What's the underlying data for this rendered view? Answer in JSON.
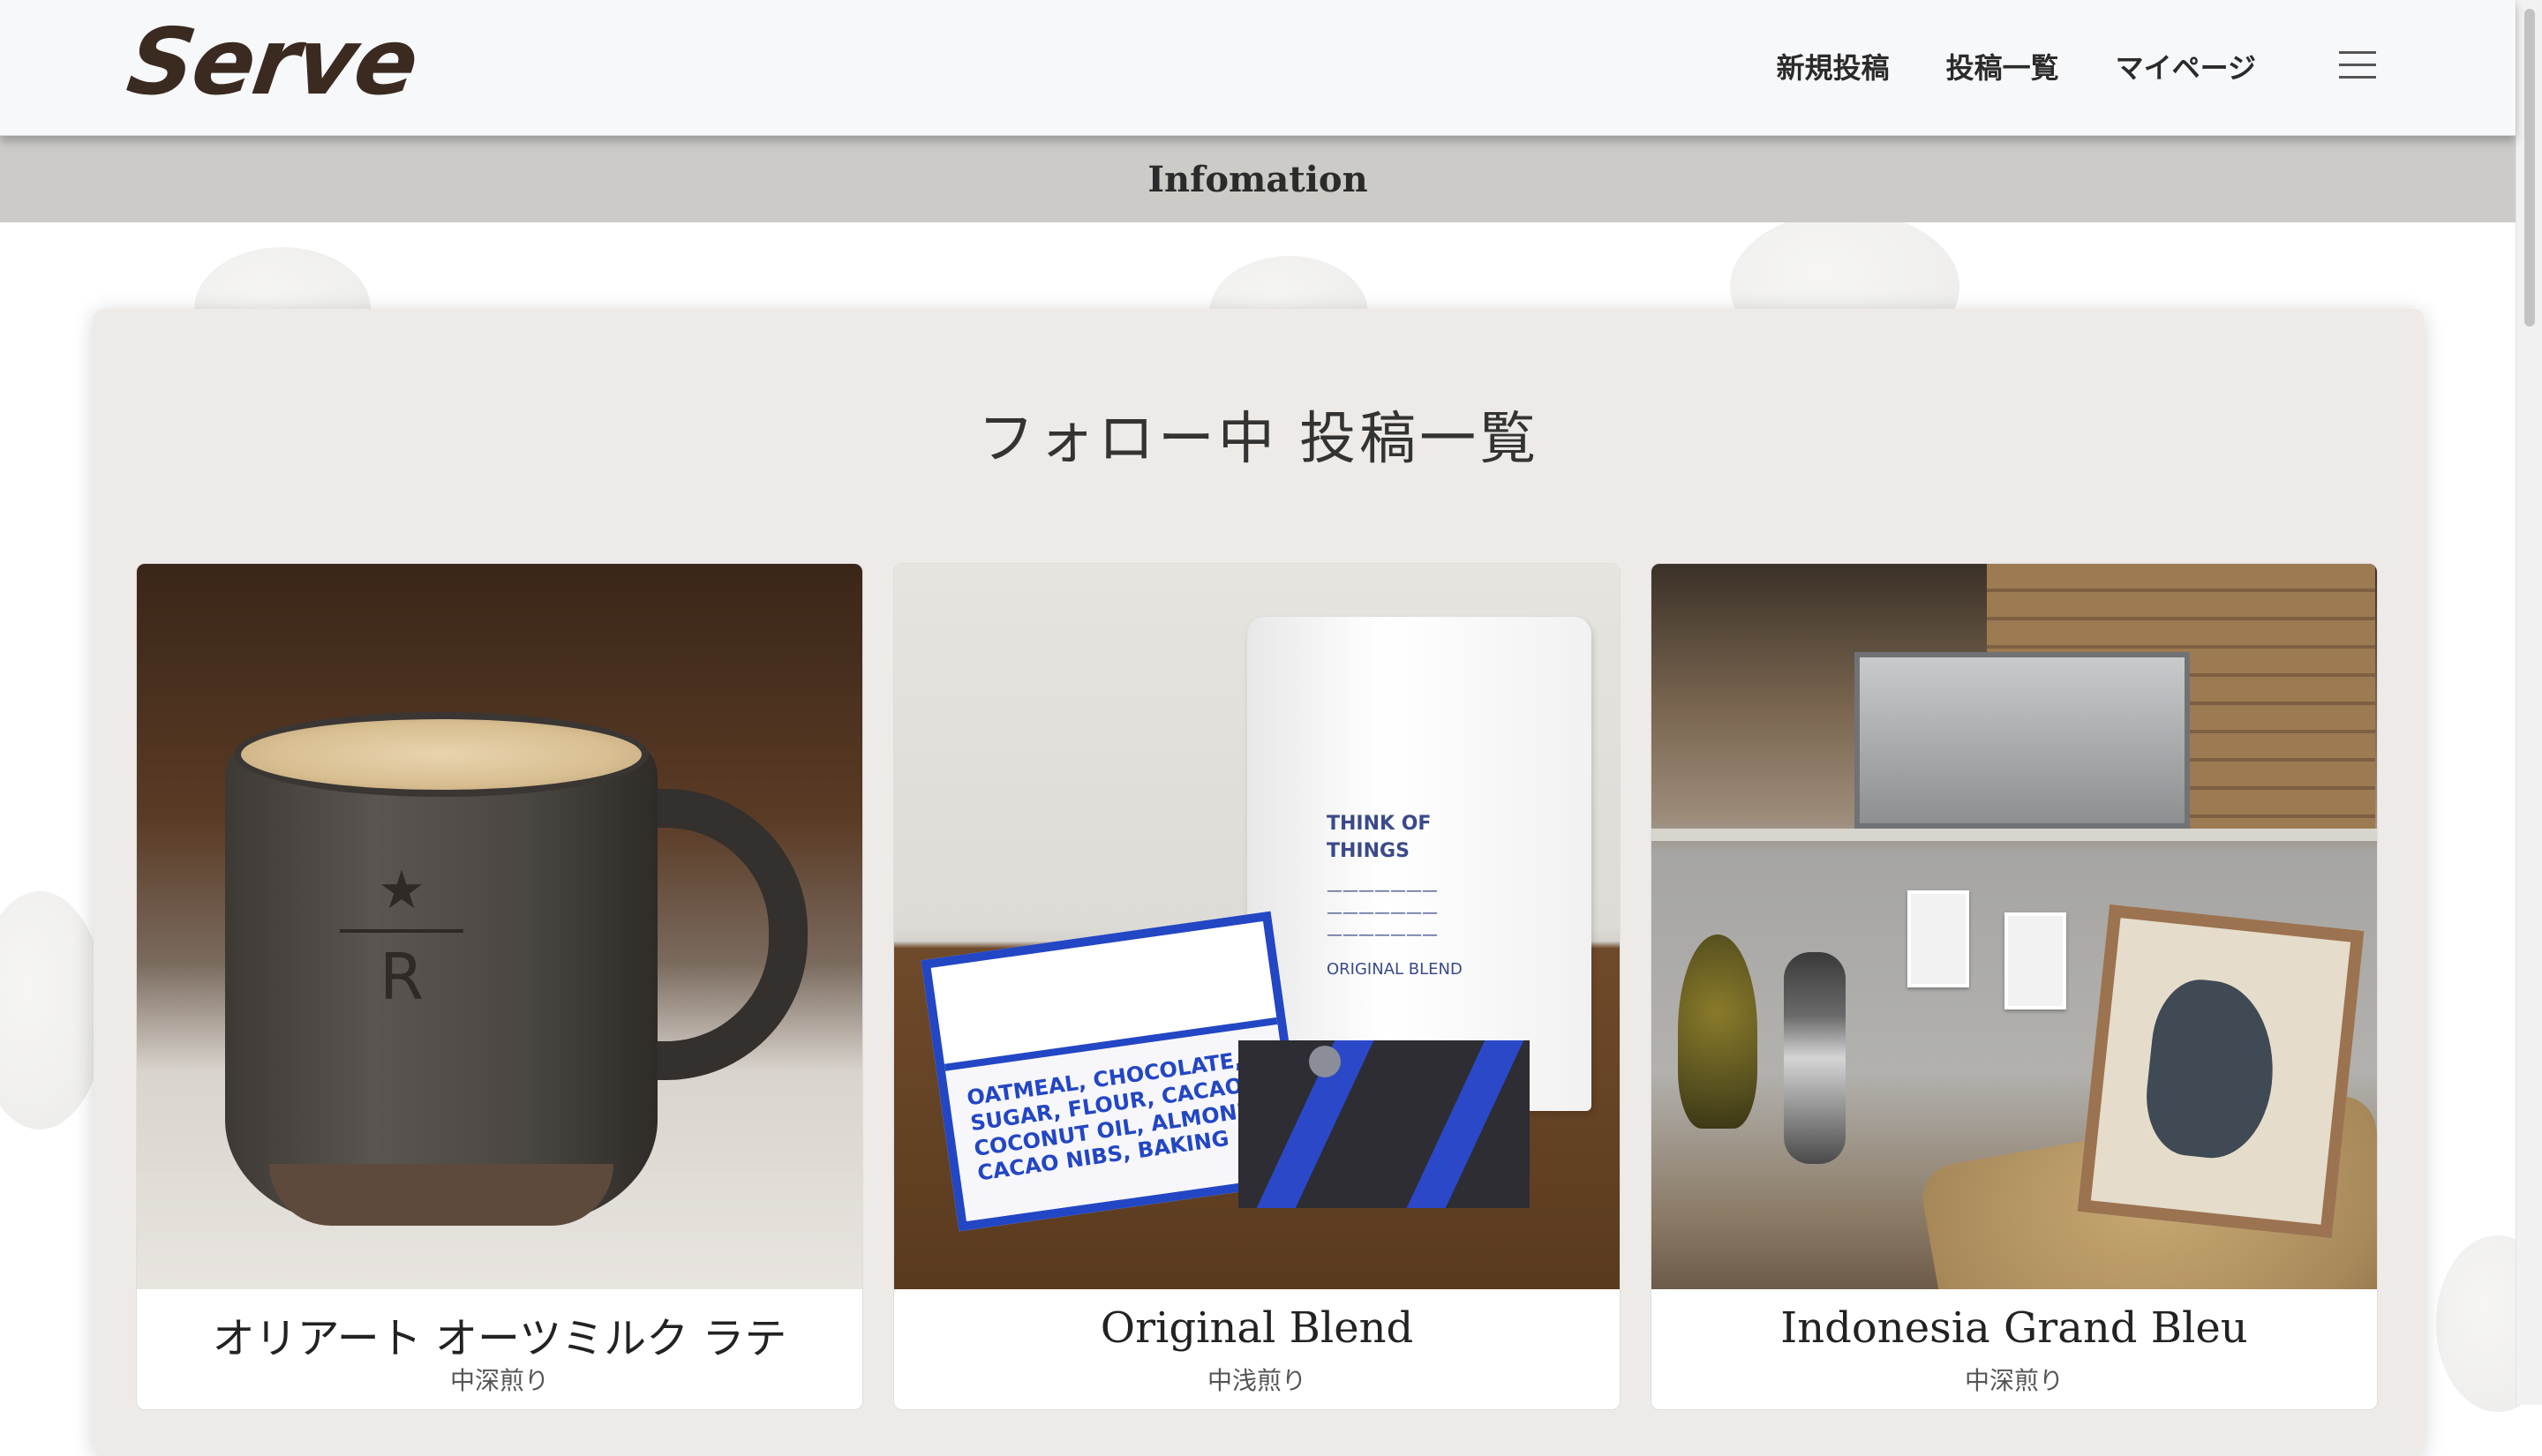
{
  "header": {
    "logo": "Serve",
    "nav": [
      {
        "label": "新規投稿"
      },
      {
        "label": "投稿一覧"
      },
      {
        "label": "マイページ"
      }
    ],
    "menu_icon": "hamburger-menu-icon"
  },
  "info_bar": {
    "label": "Infomation"
  },
  "main": {
    "title": "フォロー中 投稿一覧",
    "cards": [
      {
        "title": "オリアート オーツミルク ラテ",
        "roast": "中深煎り",
        "image": "latte-mug-photo"
      },
      {
        "title": "Original Blend",
        "roast": "中浅煎り",
        "image": "coffee-bag-photo"
      },
      {
        "title": "Indonesia Grand Bleu",
        "roast": "中深煎り",
        "image": "cafe-interior-photo"
      }
    ]
  },
  "colors": {
    "logo": "#3b2a20",
    "header_bg": "#f7f8fa",
    "info_bar_bg": "#cccbc7",
    "panel_bg": "#edeae7"
  }
}
